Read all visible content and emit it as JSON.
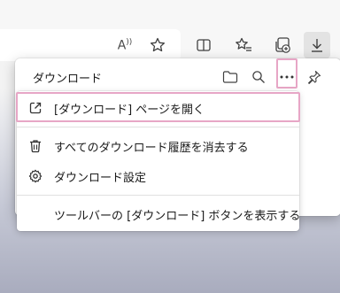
{
  "toolbar": {
    "read_aloud_label": "A",
    "read_aloud_sup": "⁾"
  },
  "downloads_panel": {
    "title": "ダウンロード",
    "menu": [
      {
        "label": "[ダウンロード] ページを開く",
        "icon": "open-external-icon",
        "highlighted": true
      },
      {
        "label": "すべてのダウンロード履歴を消去する",
        "icon": "trash-icon"
      },
      {
        "label": "ダウンロード設定",
        "icon": "gear-icon"
      },
      {
        "label": "ツールバーの [ダウンロード] ボタンを表示する",
        "icon": null
      }
    ]
  },
  "colors": {
    "highlight": "#e7a6c6",
    "panel_bg": "#ffffff",
    "toolbar_bg": "#f7f7f7"
  }
}
